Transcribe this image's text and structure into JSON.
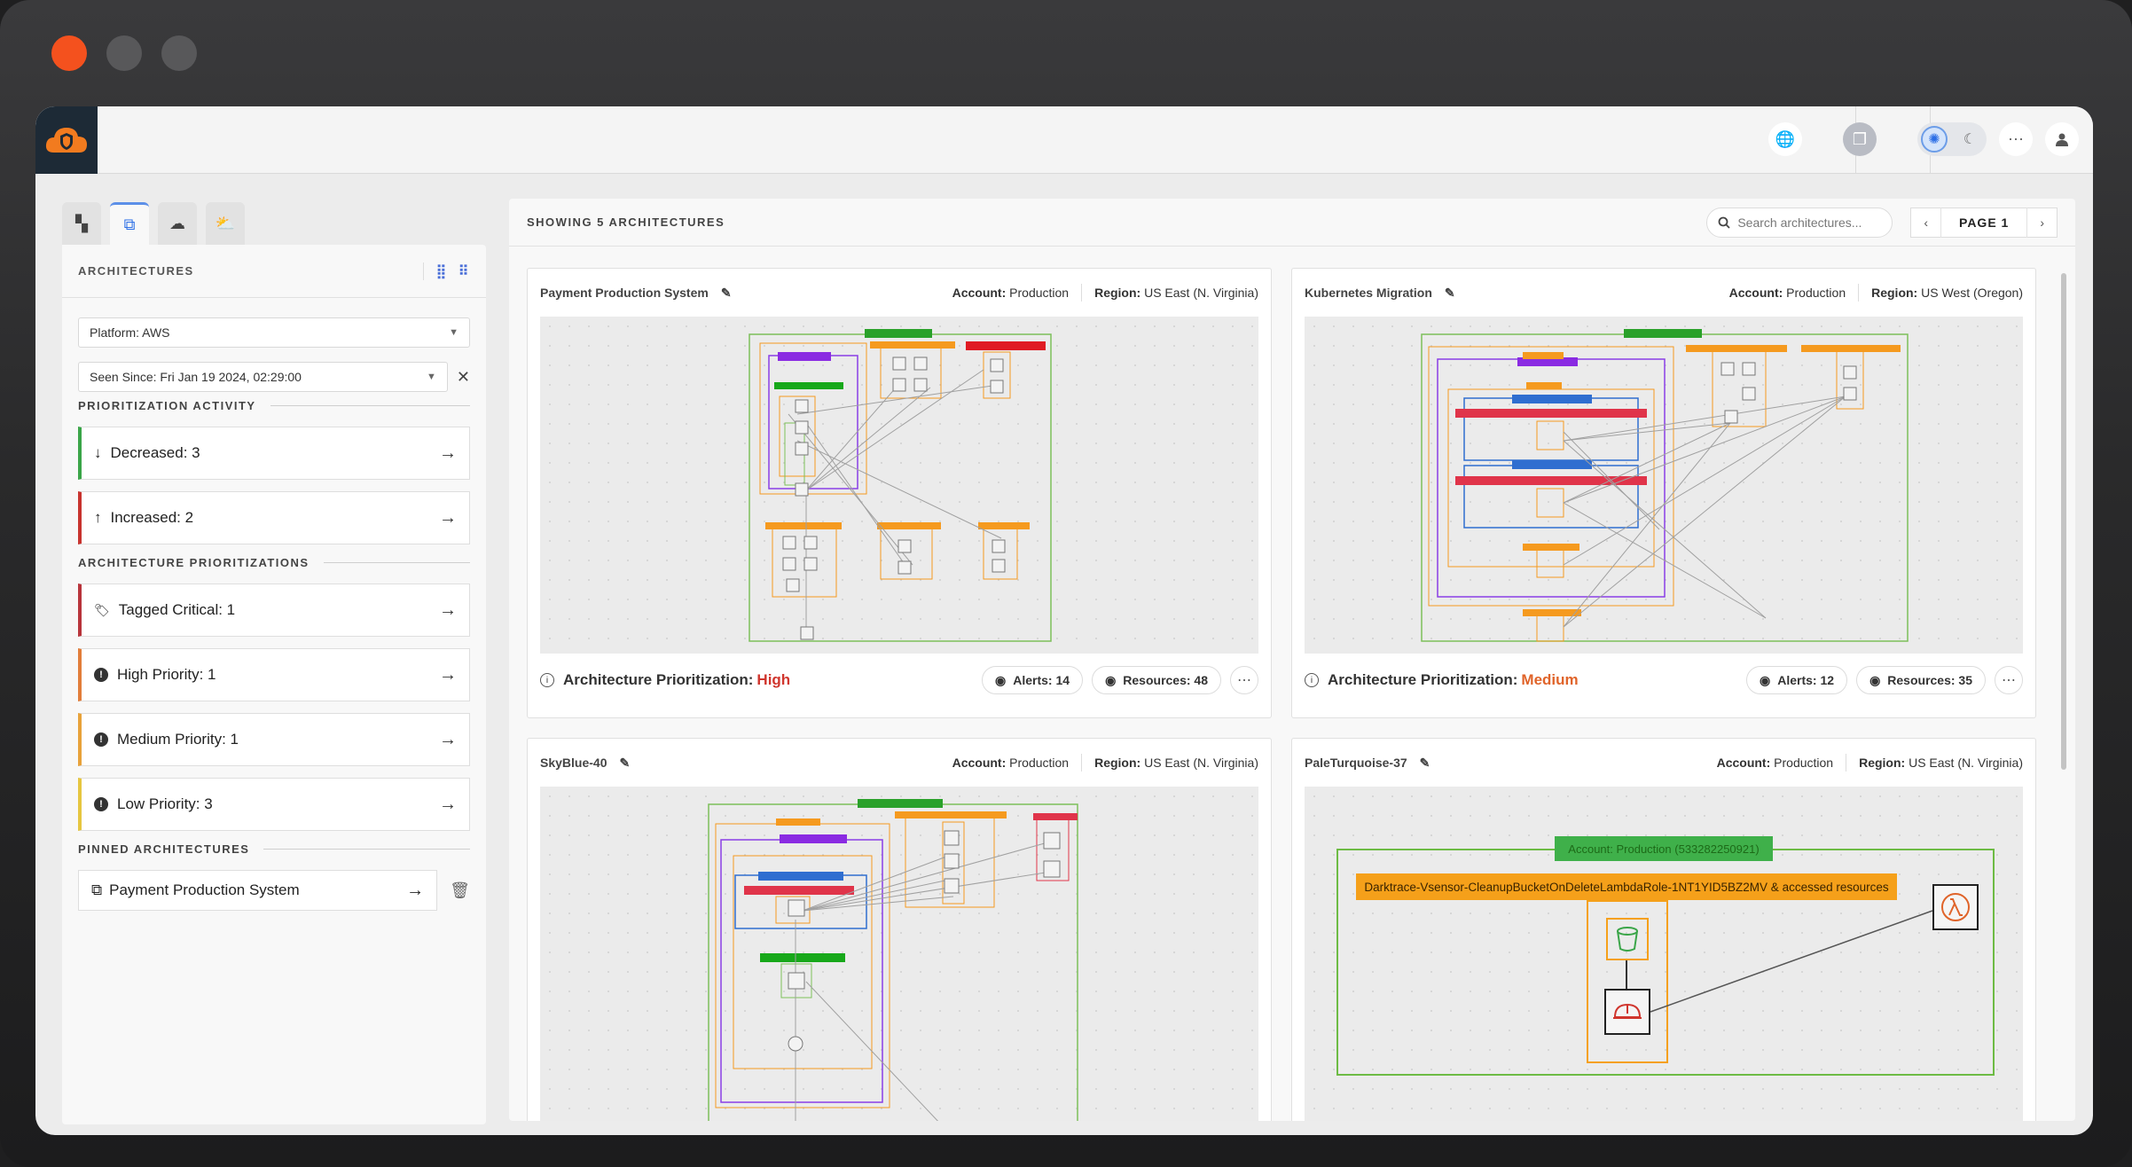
{
  "header": {
    "icons": [
      "shield-cloud-logo",
      "globe-icon",
      "copy-icon",
      "sun-icon",
      "moon-icon",
      "more-icon",
      "user-icon"
    ]
  },
  "sidebar": {
    "title": "ARCHITECTURES",
    "platform_select": "Platform: AWS",
    "seen_since_select": "Seen Since: Fri Jan 19 2024, 02:29:00",
    "clear_symbol": "✕",
    "activity_title": "PRIORITIZATION ACTIVITY",
    "activity": [
      {
        "label": "Decreased: 3",
        "symbol": "↓"
      },
      {
        "label": "Increased: 2",
        "symbol": "↑"
      }
    ],
    "prioritizations_title": "ARCHITECTURE PRIORITIZATIONS",
    "prioritizations": [
      {
        "label": "Tagged Critical: 1",
        "symbol": "🏷"
      },
      {
        "label": "High Priority: 1",
        "symbol": "!"
      },
      {
        "label": "Medium Priority: 1",
        "symbol": "!"
      },
      {
        "label": "Low Priority: 3",
        "symbol": "!"
      }
    ],
    "pinned_title": "PINNED ARCHITECTURES",
    "pinned": [
      {
        "label": "Payment Production System"
      }
    ]
  },
  "main": {
    "count_label": "SHOWING 5 ARCHITECTURES",
    "search_placeholder": "Search architectures...",
    "page_label": "PAGE 1",
    "cards": [
      {
        "title": "Payment Production System",
        "account_label": "Account:",
        "account": "Production",
        "region_label": "Region:",
        "region": "US East (N. Virginia)",
        "prioritization_label": "Architecture Prioritization:",
        "prioritization": "High",
        "alerts": "Alerts: 14",
        "resources": "Resources: 48"
      },
      {
        "title": "Kubernetes Migration",
        "account_label": "Account:",
        "account": "Production",
        "region_label": "Region:",
        "region": "US West (Oregon)",
        "prioritization_label": "Architecture Prioritization:",
        "prioritization": "Medium",
        "alerts": "Alerts: 12",
        "resources": "Resources: 35"
      },
      {
        "title": "SkyBlue-40",
        "account_label": "Account:",
        "account": "Production",
        "region_label": "Region:",
        "region": "US East (N. Virginia)"
      },
      {
        "title": "PaleTurquoise-37",
        "account_label": "Account:",
        "account": "Production",
        "region_label": "Region:",
        "region": "US East (N. Virginia)",
        "diagram_account": "Account: Production (533282250921)",
        "diagram_role": "Darktrace-Vsensor-CleanupBucketOnDeleteLambdaRole-1NT1YID5BZ2MV & accessed resources"
      }
    ]
  },
  "colors": {
    "accent": "#2b6ee6",
    "high": "#d0362e",
    "medium": "#e0642a",
    "diagram_green": "#7cc05a",
    "diagram_orange": "#f59a1f",
    "diagram_purple": "#8a3ee6",
    "diagram_red": "#e0344a",
    "diagram_blue": "#2f6ed0"
  }
}
